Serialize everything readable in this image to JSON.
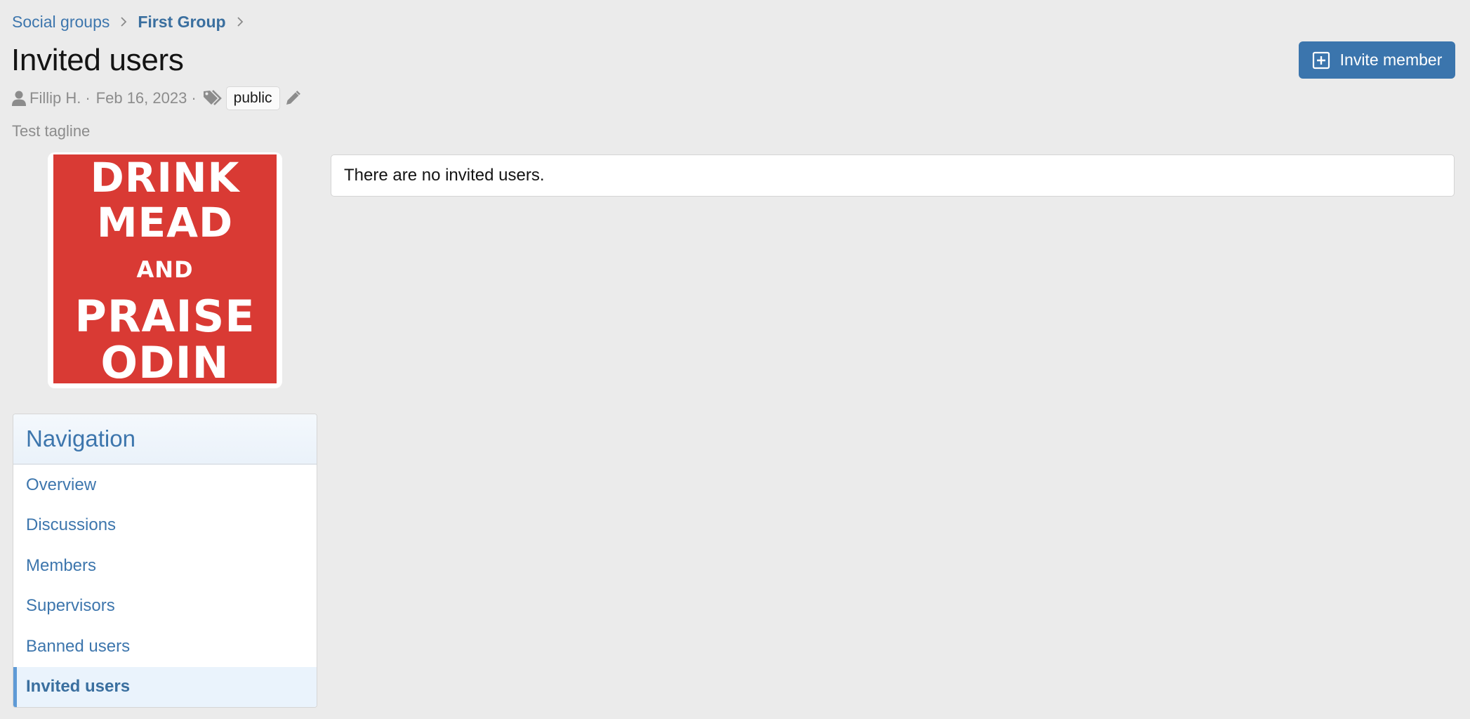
{
  "breadcrumb": {
    "items": [
      {
        "label": "Social groups",
        "bold": false
      },
      {
        "label": "First Group",
        "bold": true
      }
    ]
  },
  "header": {
    "title": "Invited users",
    "invite_button_label": "Invite member"
  },
  "meta": {
    "author": "Fillip H.",
    "date": "Feb 16, 2023",
    "separator": "·",
    "tag": "public"
  },
  "tagline": "Test tagline",
  "avatar": {
    "lines": [
      "DRINK",
      "MEAD",
      "AND",
      "PRAISE",
      "ODIN"
    ],
    "background": "#d93a34",
    "text_color": "#ffffff"
  },
  "navigation": {
    "title": "Navigation",
    "items": [
      {
        "label": "Overview",
        "active": false
      },
      {
        "label": "Discussions",
        "active": false
      },
      {
        "label": "Members",
        "active": false
      },
      {
        "label": "Supervisors",
        "active": false
      },
      {
        "label": "Banned users",
        "active": false
      },
      {
        "label": "Invited users",
        "active": true
      }
    ]
  },
  "content": {
    "empty_message": "There are no invited users."
  },
  "colors": {
    "accent": "#3b75ad",
    "link": "#3d76ad",
    "active_border": "#5e9ad6",
    "page_background": "#ebebeb"
  }
}
